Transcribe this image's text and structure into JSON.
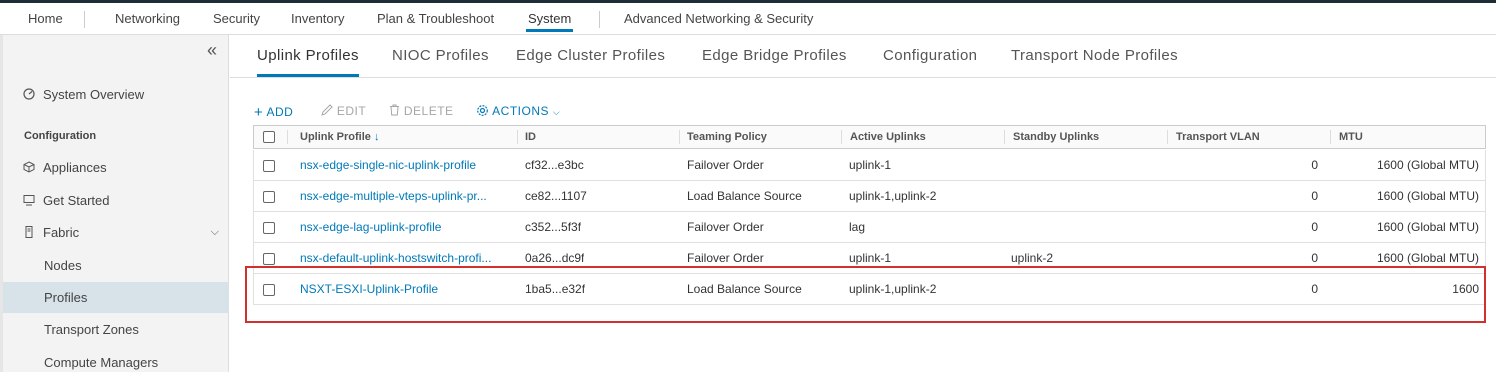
{
  "topnav": {
    "items": [
      {
        "label": "Home"
      },
      {
        "label": "Networking"
      },
      {
        "label": "Security"
      },
      {
        "label": "Inventory"
      },
      {
        "label": "Plan & Troubleshoot"
      },
      {
        "label": "System",
        "active": true
      },
      {
        "label": "Advanced Networking & Security"
      }
    ]
  },
  "sidebar": {
    "collapse_icon": "double-chevron-left-icon",
    "overview": {
      "label": "System Overview",
      "icon": "dashboard-icon"
    },
    "section_header": "Configuration",
    "items": [
      {
        "label": "Appliances",
        "icon": "cube-icon"
      },
      {
        "label": "Get Started",
        "icon": "monitor-icon"
      },
      {
        "label": "Fabric",
        "icon": "server-icon",
        "expanded": true
      }
    ],
    "subitems": [
      {
        "label": "Nodes"
      },
      {
        "label": "Profiles",
        "active": true
      },
      {
        "label": "Transport Zones"
      },
      {
        "label": "Compute Managers"
      }
    ]
  },
  "tabs": [
    {
      "label": "Uplink Profiles",
      "active": true
    },
    {
      "label": "NIOC Profiles"
    },
    {
      "label": "Edge Cluster Profiles"
    },
    {
      "label": "Edge Bridge Profiles"
    },
    {
      "label": "Configuration"
    },
    {
      "label": "Transport Node Profiles"
    }
  ],
  "actions": {
    "add": "ADD",
    "edit": "EDIT",
    "delete": "DELETE",
    "actions": "ACTIONS"
  },
  "grid": {
    "columns": [
      "Uplink Profile",
      "ID",
      "Teaming Policy",
      "Active Uplinks",
      "Standby Uplinks",
      "Transport VLAN",
      "MTU"
    ],
    "sort_indicator": "↓",
    "rows": [
      {
        "name": "nsx-edge-single-nic-uplink-profile",
        "id": "cf32...e3bc",
        "teaming": "Failover Order",
        "active": "uplink-1",
        "standby": "",
        "vlan": "0",
        "mtu": "1600 (Global MTU)"
      },
      {
        "name": "nsx-edge-multiple-vteps-uplink-pr...",
        "id": "ce82...1107",
        "teaming": "Load Balance Source",
        "active": "uplink-1,uplink-2",
        "standby": "",
        "vlan": "0",
        "mtu": "1600 (Global MTU)"
      },
      {
        "name": "nsx-edge-lag-uplink-profile",
        "id": "c352...5f3f",
        "teaming": "Failover Order",
        "active": "lag",
        "standby": "",
        "vlan": "0",
        "mtu": "1600 (Global MTU)"
      },
      {
        "name": "nsx-default-uplink-hostswitch-profi...",
        "id": "0a26...dc9f",
        "teaming": "Failover Order",
        "active": "uplink-1",
        "standby": "uplink-2",
        "vlan": "0",
        "mtu": "1600 (Global MTU)"
      },
      {
        "name": "NSXT-ESXI-Uplink-Profile",
        "id": "1ba5...e32f",
        "teaming": "Load Balance Source",
        "active": "uplink-1,uplink-2",
        "standby": "",
        "vlan": "0",
        "mtu": "1600"
      }
    ]
  },
  "colors": {
    "accent": "#0079b8",
    "highlight_box": "#d0312d",
    "active_nav_bg": "#d8e3e9"
  }
}
